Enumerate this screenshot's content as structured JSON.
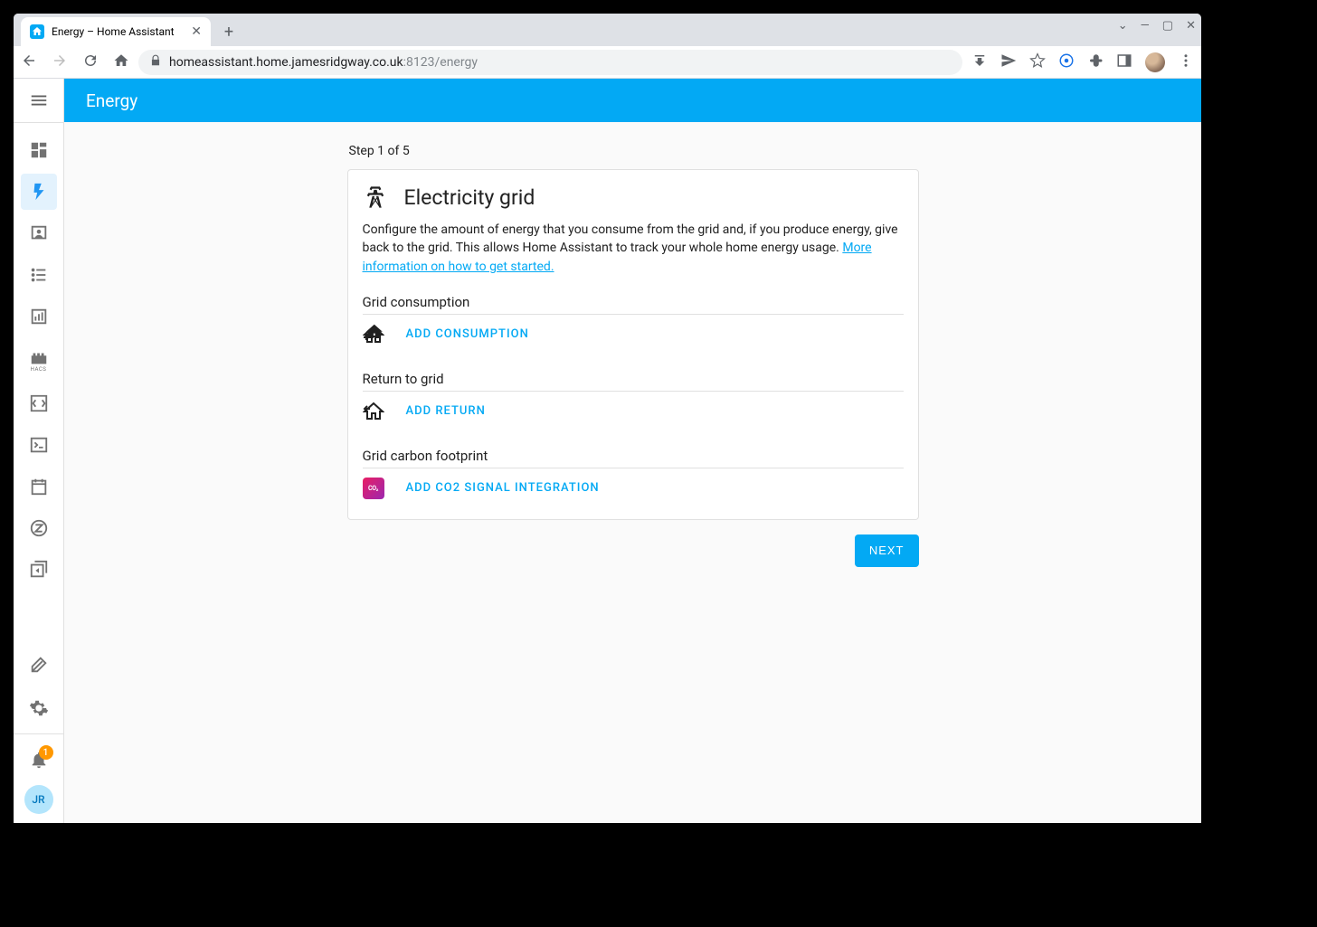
{
  "browser": {
    "tab_title": "Energy – Home Assistant",
    "url_host": "homeassistant.home.jamesridgway.co.uk",
    "url_port_path": ":8123/energy"
  },
  "sidebar": {
    "notification_count": "1",
    "avatar_initials": "JR"
  },
  "header": {
    "title": "Energy"
  },
  "wizard": {
    "step_label": "Step 1 of 5",
    "card_title": "Electricity grid",
    "card_desc": "Configure the amount of energy that you consume from the grid and, if you produce energy, give back to the grid. This allows Home Assistant to track your whole home energy usage. ",
    "card_desc_link": "More information on how to get started.",
    "sections": {
      "consumption": {
        "title": "Grid consumption",
        "action": "Add consumption"
      },
      "return": {
        "title": "Return to grid",
        "action": "Add return"
      },
      "carbon": {
        "title": "Grid carbon footprint",
        "action": "Add CO2 signal integration",
        "chip": "CO₂"
      }
    },
    "next_label": "Next"
  }
}
